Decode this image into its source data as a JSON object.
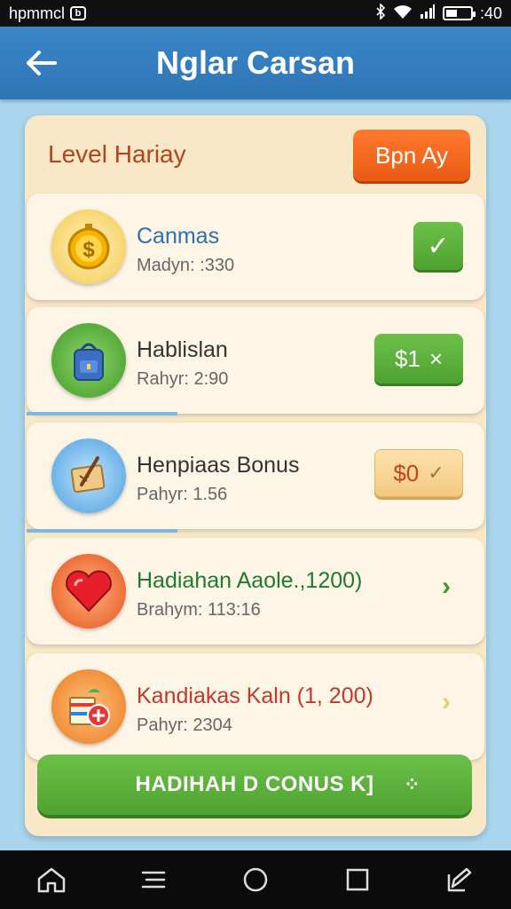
{
  "status_bar": {
    "left_text": "hpmmcl",
    "app_icon": "b",
    "time": ":40",
    "icons": [
      "bluetooth-icon",
      "wifi-icon",
      "signal-icon",
      "battery-icon"
    ]
  },
  "app_bar": {
    "title": "Nglar Carsan",
    "back_icon": "arrow-left-icon"
  },
  "panel": {
    "title": "Level Hariay",
    "header_button": "Bpn Ay",
    "items": [
      {
        "title": "Canmas",
        "subtitle": "Madyn: :330",
        "icon": "coin-clock-icon",
        "action": "check",
        "action_label": "✓",
        "title_color": "#2f6fb0"
      },
      {
        "title": "Hablislan",
        "subtitle": "Rahyr: 2:90",
        "icon": "backpack-icon",
        "action": "price",
        "action_label": "$1",
        "action_symbol": "×"
      },
      {
        "title": "Henpiaas Bonus",
        "subtitle": "Pahyr: 1.56",
        "icon": "scroll-icon",
        "action": "price-soft",
        "action_label": "$0",
        "action_symbol": "✓"
      },
      {
        "title": "Hadiahan Aaole.,1200)",
        "subtitle": "Brahym: 113:16",
        "icon": "heart-icon",
        "action": "chevron",
        "action_symbol": "›",
        "title_color": "#1f7a2e"
      },
      {
        "title": "Kandiakas Kaln (1, 200)",
        "subtitle": "Pahyr: 2304",
        "icon": "gift-box-icon",
        "action": "chevron",
        "action_symbol": "›",
        "title_color": "#c0392b"
      }
    ],
    "claim_button": "HADIHAH D CONUS K]",
    "claim_dots": "⁘"
  },
  "nav_bar": {
    "items": [
      "home-icon",
      "menu-icon",
      "circle-home-icon",
      "recents-icon",
      "edit-icon"
    ]
  },
  "colors": {
    "accent_orange": "#ea5a14",
    "accent_green": "#4ea22e",
    "app_bar_blue": "#2f75b5",
    "background": "#a9d6ee"
  }
}
